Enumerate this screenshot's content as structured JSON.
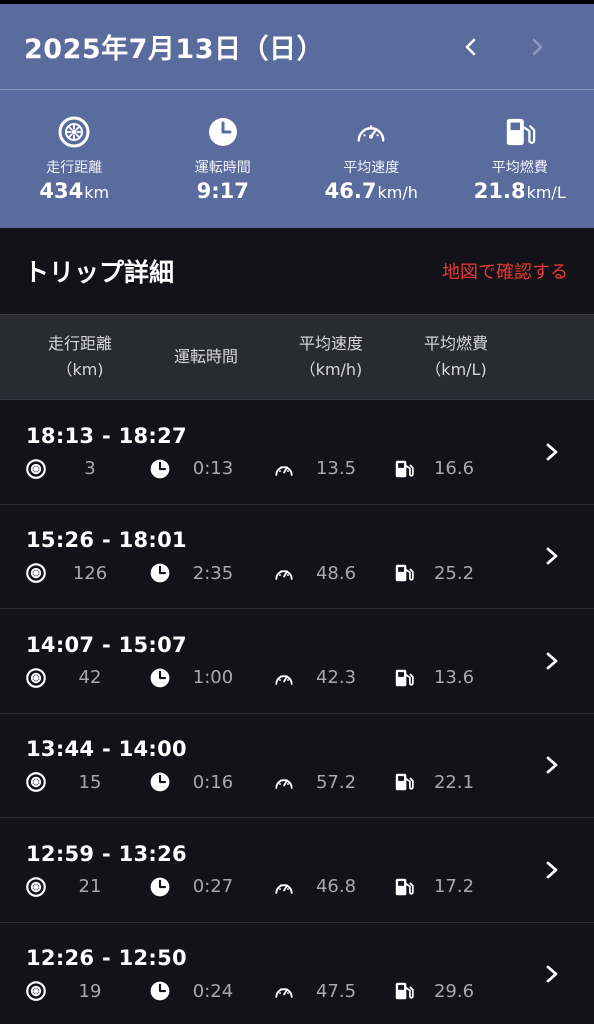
{
  "header": {
    "date": "2025年7月13日（日）",
    "prev_icon": "chevron-left-icon",
    "next_icon": "chevron-right-icon"
  },
  "summary": {
    "distance": {
      "label": "走行距離",
      "value": "434",
      "unit": "km",
      "icon": "tire-icon"
    },
    "time": {
      "label": "運転時間",
      "value": "9:17",
      "unit": "",
      "icon": "clock-icon"
    },
    "speed": {
      "label": "平均速度",
      "value": "46.7",
      "unit": "km/h",
      "icon": "speedometer-icon"
    },
    "fuel": {
      "label": "平均燃費",
      "value": "21.8",
      "unit": "km/L",
      "icon": "fuel-pump-icon"
    }
  },
  "section": {
    "title": "トリップ詳細",
    "map_link": "地図で確認する"
  },
  "columns": [
    "走行距離\n（km)",
    "運転時間",
    "平均速度\n（km/h)",
    "平均燃費\n（km/L)"
  ],
  "trips": [
    {
      "time": "18:13 - 18:27",
      "distance": "3",
      "duration": "0:13",
      "speed": "13.5",
      "fuel": "16.6"
    },
    {
      "time": "15:26 - 18:01",
      "distance": "126",
      "duration": "2:35",
      "speed": "48.6",
      "fuel": "25.2"
    },
    {
      "time": "14:07 - 15:07",
      "distance": "42",
      "duration": "1:00",
      "speed": "42.3",
      "fuel": "13.6"
    },
    {
      "time": "13:44 - 14:00",
      "distance": "15",
      "duration": "0:16",
      "speed": "57.2",
      "fuel": "22.1"
    },
    {
      "time": "12:59 - 13:26",
      "distance": "21",
      "duration": "0:27",
      "speed": "46.8",
      "fuel": "17.2"
    },
    {
      "time": "12:26 - 12:50",
      "distance": "19",
      "duration": "0:24",
      "speed": "47.5",
      "fuel": "29.6"
    }
  ],
  "colors": {
    "summary_bg": "#5a6b9d",
    "page_bg": "#121218",
    "accent_red": "#e53935"
  }
}
